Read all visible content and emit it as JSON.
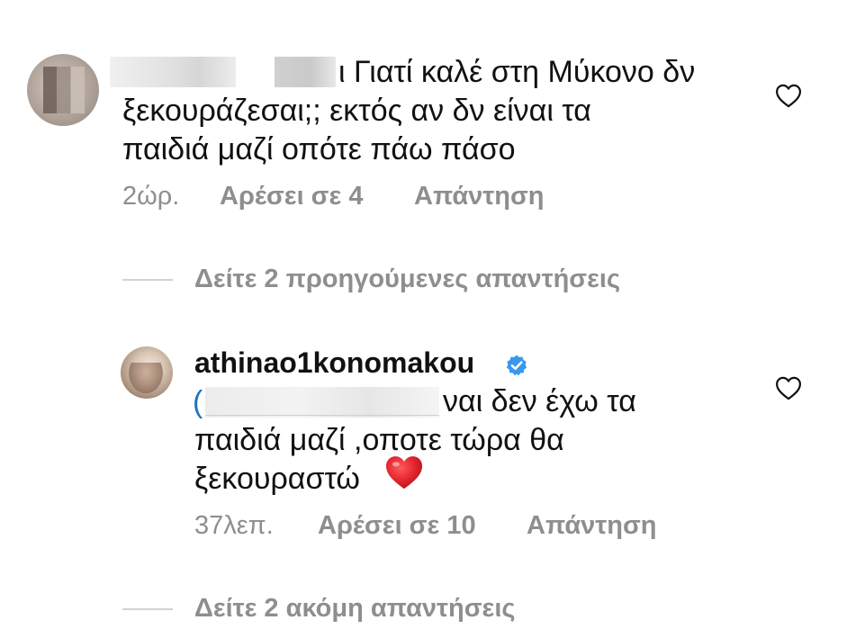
{
  "comment1": {
    "text_line1": "ι Γιατί καλέ στη Μύκονο δν",
    "text_line2": "ξεκουράζεσαι;; εκτός αν δν είναι τα",
    "text_line3": "παιδιά μαζί οπότε πάω πάσο",
    "time": "2ώρ.",
    "likes": "Αρέσει σε 4",
    "reply": "Απάντηση"
  },
  "view_previous_replies": "Δείτε 2 προηγούμενες απαντήσεις",
  "comment2": {
    "username": "athinao1konomakou",
    "text_line1_tail": "ναι δεν έχω τα",
    "text_line2": "παιδιά μαζί ,οποτε τώρα θα",
    "text_line3": "ξεκουραστώ",
    "time": "37λεπ.",
    "likes": "Αρέσει σε 10",
    "reply": "Απάντηση"
  },
  "view_more_replies": "Δείτε 2 ακόμη απαντήσεις",
  "icons": {
    "like": "heart-outline-icon",
    "verified": "verified-badge-icon",
    "emoji": "red-heart-emoji"
  },
  "colors": {
    "text": "#111111",
    "meta": "#8e8e8e",
    "verified": "#3897f0",
    "heart": "#e0232a",
    "divider": "#d2d2d2"
  }
}
